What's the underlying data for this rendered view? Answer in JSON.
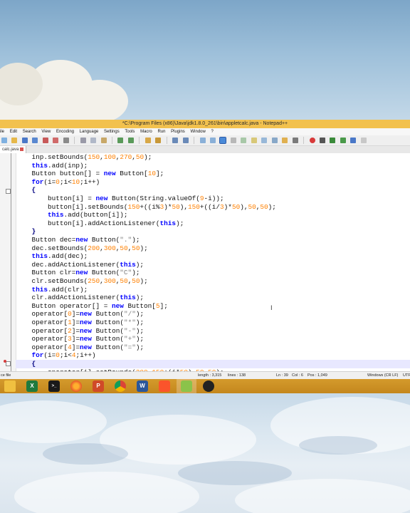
{
  "window": {
    "title": "*C:\\Program Files (x86)\\Java\\jdk1.8.0_261\\bin\\appletcalc.java - Notepad++"
  },
  "menu": [
    "ile",
    "Edit",
    "Search",
    "View",
    "Encoding",
    "Language",
    "Settings",
    "Tools",
    "Macro",
    "Run",
    "Plugins",
    "Window",
    "?"
  ],
  "tab": {
    "label": "calc.java"
  },
  "code_lines": [
    "    inp.setBounds(150,100,270,50);",
    "    this.add(inp);",
    "    Button button[] = new Button[10];",
    "    for(i=0;i<10;i++)",
    "    {",
    "        button[i] = new Button(String.valueOf(9-i));",
    "        button[i].setBounds(150+((i%3)*50),150+((i/3)*50),50,50);",
    "        this.add(button[i]);",
    "        button[i].addActionListener(this);",
    "    }",
    "    Button dec=new Button(\".\");",
    "    dec.setBounds(200,300,50,50);",
    "    this.add(dec);",
    "    dec.addActionListener(this);",
    "    Button clr=new Button(\"C\");",
    "    clr.setBounds(250,300,50,50);",
    "    this.add(clr);",
    "    clr.addActionListener(this);",
    "    Button operator[] = new Button[5];",
    "    operator[0]=new Button(\"/\");",
    "    operator[1]=new Button(\"*\");",
    "    operator[2]=new Button(\"-\");",
    "    operator[3]=new Button(\"+\");",
    "    operator[4]=new Button(\"=\");",
    "    for(i=0;i<4;i++)",
    "    {",
    "        operator[i].setBounds(300,150+(i*50),50,50);"
  ],
  "status": {
    "file_type": "ce file",
    "length": "length : 3,315",
    "lines": "lines : 138",
    "ln": "Ln : 39",
    "col": "Col : 6",
    "pos": "Pos : 1,049",
    "eol": "Windows (CR LF)",
    "encoding": "UTF-8"
  },
  "taskbar": {
    "apps": [
      {
        "name": "file-explorer",
        "glyph": ""
      },
      {
        "name": "excel",
        "glyph": "X"
      },
      {
        "name": "terminal",
        "glyph": ">_"
      },
      {
        "name": "firefox",
        "glyph": ""
      },
      {
        "name": "powerpoint",
        "glyph": "P"
      },
      {
        "name": "chrome",
        "glyph": ""
      },
      {
        "name": "word",
        "glyph": "W"
      },
      {
        "name": "brave",
        "glyph": ""
      },
      {
        "name": "notepad-plus-plus",
        "glyph": ""
      },
      {
        "name": "obs",
        "glyph": ""
      }
    ]
  },
  "colors": {
    "titlebar": "#f2c14e",
    "taskbar": "#c98d22",
    "keyword": "#0000ff",
    "number": "#ff8000",
    "string": "#808080",
    "current_line": "#e8e8ff"
  }
}
